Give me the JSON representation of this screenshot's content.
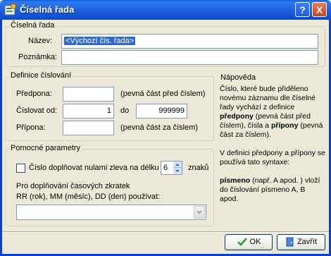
{
  "window": {
    "title": "Číselná řada",
    "help_button": "?",
    "close_button": "X"
  },
  "header_group": {
    "title": "Číselná řada",
    "name_label": "Název:",
    "name_value": "<Výchozí čís. řada>",
    "note_label": "Poznámka:",
    "note_value": ""
  },
  "numbering": {
    "title": "Definice číslování",
    "prefix_label": "Předpona:",
    "prefix_value": "",
    "prefix_hint": "(pevná část před číslem)",
    "from_label": "Číslovat od:",
    "from_value": "1",
    "to_label": "do",
    "to_value": "999999",
    "suffix_label": "Přípona:",
    "suffix_value": "",
    "suffix_hint": "(pevná část za číslem)"
  },
  "aux": {
    "title": "Pomocné parametry",
    "pad_checkbox_label": "Číslo doplňovat nulami zleva na délku",
    "pad_checked": false,
    "pad_length": "6",
    "pad_unit": "znaků",
    "abbr_line1": "Pro doplňování časových zkratek",
    "abbr_line2": "RR (rok), MM (měsíc), DD (den) používat:",
    "abbr_selected": ""
  },
  "help": {
    "title": "Nápověda",
    "p1_a": "Číslo, které bude přiděleno novému záznamu dle číselné řady vychází z definice ",
    "p1_b": "předpony",
    "p1_c": " (pevná část před číslem), čísla a ",
    "p1_d": "přípony",
    "p1_e": " (pevná část za číslem).",
    "p2": "V definici předpony a přípony se používá tato syntaxe:",
    "p3_a": "písmeno",
    "p3_b": " (např. A apod. ) vloží do číslování písmeno A, B apod."
  },
  "buttons": {
    "ok": "OK",
    "close": "Zavřít"
  },
  "colors": {
    "titlebar": "#0A5FE0",
    "dialog_bg": "#ECE9D8",
    "selection": "#3169C6"
  }
}
